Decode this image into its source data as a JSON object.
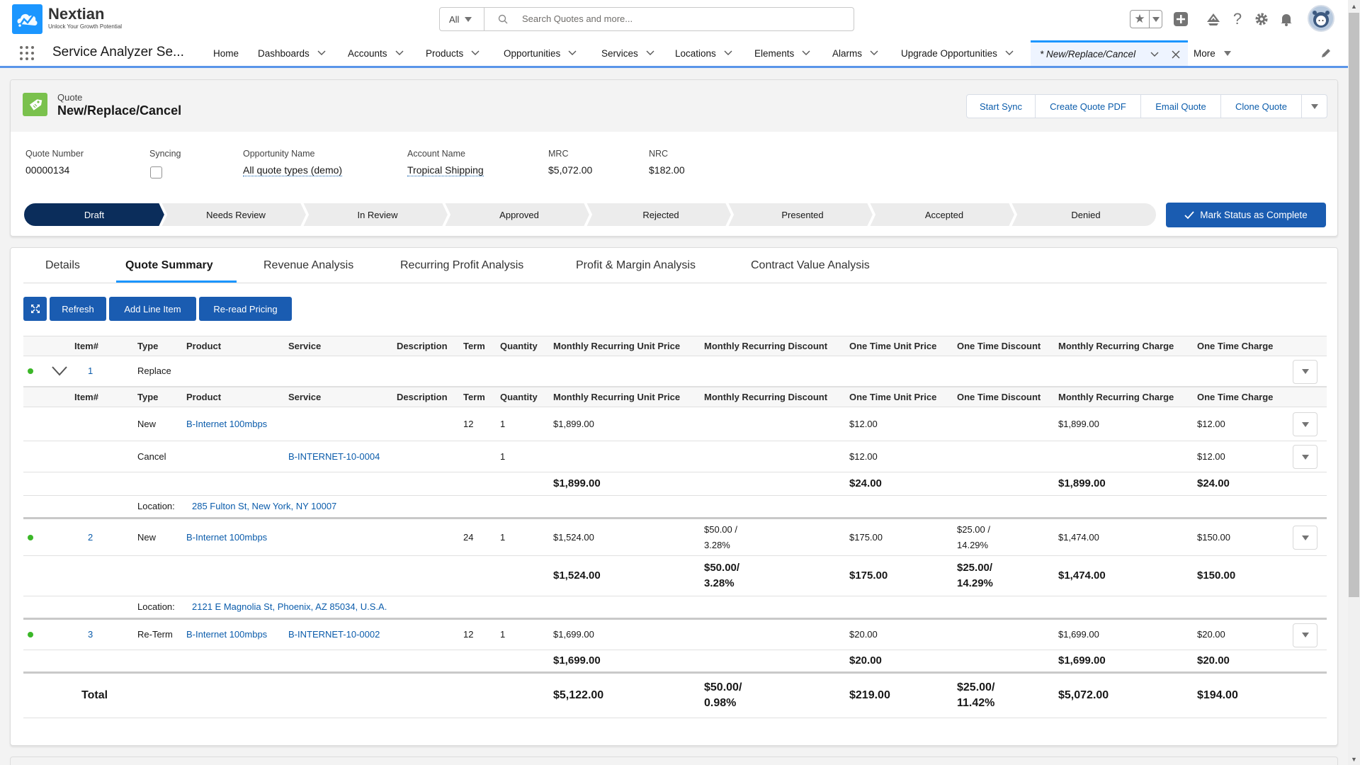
{
  "brand": {
    "name": "Nextian",
    "tagline": "Unlock Your Growth Potential"
  },
  "search": {
    "scope": "All",
    "placeholder": "Search Quotes and more..."
  },
  "header_icons": [
    "favorites-star-icon",
    "add-icon",
    "trailhead-icon",
    "help-icon",
    "setup-gear-icon",
    "notifications-bell-icon",
    "user-avatar"
  ],
  "nav": {
    "app_name": "Service Analyzer Se...",
    "items": [
      {
        "label": "Home",
        "dropdown": false
      },
      {
        "label": "Dashboards",
        "dropdown": true
      },
      {
        "label": "Accounts",
        "dropdown": true
      },
      {
        "label": "Products",
        "dropdown": true
      },
      {
        "label": "Opportunities",
        "dropdown": true
      },
      {
        "label": "Services",
        "dropdown": true
      },
      {
        "label": "Locations",
        "dropdown": true
      },
      {
        "label": "Elements",
        "dropdown": true
      },
      {
        "label": "Alarms",
        "dropdown": true
      },
      {
        "label": "Upgrade Opportunities",
        "dropdown": true
      }
    ],
    "active_tab": "* New/Replace/Cancel",
    "more": "More"
  },
  "record": {
    "object_label": "Quote",
    "title": "New/Replace/Cancel",
    "actions": [
      "Start Sync",
      "Create Quote PDF",
      "Email Quote",
      "Clone Quote"
    ],
    "fields": [
      {
        "label": "Quote Number",
        "value": "00000134"
      },
      {
        "label": "Syncing",
        "value": false
      },
      {
        "label": "Opportunity Name",
        "value": "All quote types (demo)"
      },
      {
        "label": "Account Name",
        "value": "Tropical Shipping"
      },
      {
        "label": "MRC",
        "value": "$5,072.00"
      },
      {
        "label": "NRC",
        "value": "$182.00"
      }
    ],
    "path": {
      "stages": [
        "Draft",
        "Needs Review",
        "In Review",
        "Approved",
        "Rejected",
        "Presented",
        "Accepted",
        "Denied"
      ],
      "current": "Draft",
      "complete_button": "Mark Status as Complete"
    }
  },
  "tabs": [
    {
      "label": "Details",
      "active": false
    },
    {
      "label": "Quote Summary",
      "active": true
    },
    {
      "label": "Revenue Analysis",
      "active": false
    },
    {
      "label": "Recurring Profit Analysis",
      "active": false
    },
    {
      "label": "Profit & Margin Analysis",
      "active": false
    },
    {
      "label": "Contract Value Analysis",
      "active": false
    }
  ],
  "toolbar": {
    "refresh": "Refresh",
    "add_line_item": "Add Line Item",
    "reread_pricing": "Re-read Pricing"
  },
  "table": {
    "columns": [
      "Item#",
      "Type",
      "Product",
      "Service",
      "Description",
      "Term",
      "Quantity",
      "Monthly Recurring Unit Price",
      "Monthly Recurring Discount",
      "One Time Unit Price",
      "One Time Discount",
      "Monthly Recurring Charge",
      "One Time Charge"
    ],
    "location_label": "Location:",
    "groups": [
      {
        "item": "1",
        "type": "Replace",
        "children": [
          {
            "type": "New",
            "product": "B-Internet 100mbps",
            "service": "",
            "term": "12",
            "quantity": "1",
            "mrup": "$1,899.00",
            "mrd": "",
            "otup": "$12.00",
            "otd": "",
            "mrc": "$1,899.00",
            "otc": "$12.00"
          },
          {
            "type": "Cancel",
            "product": "",
            "service": "B-INTERNET-10-0004",
            "term": "",
            "quantity": "1",
            "mrup": "",
            "mrd": "",
            "otup": "$12.00",
            "otd": "",
            "mrc": "",
            "otc": "$12.00"
          }
        ],
        "subtotal": {
          "mrup": "$1,899.00",
          "mrd": "",
          "otup": "$24.00",
          "otd": "",
          "mrc": "$1,899.00",
          "otc": "$24.00"
        },
        "location": "285 Fulton St, New York, NY 10007"
      },
      {
        "item": "2",
        "type": "New",
        "product": "B-Internet 100mbps",
        "service": "",
        "term": "24",
        "quantity": "1",
        "mrup": "$1,524.00",
        "mrd": "$50.00 / 3.28%",
        "otup": "$175.00",
        "otd": "$25.00 / 14.29%",
        "mrc": "$1,474.00",
        "otc": "$150.00",
        "subtotal": {
          "mrup": "$1,524.00",
          "mrd": "$50.00/ 3.28%",
          "otup": "$175.00",
          "otd": "$25.00/ 14.29%",
          "mrc": "$1,474.00",
          "otc": "$150.00"
        },
        "location": "2121 E Magnolia St, Phoenix, AZ 85034, U.S.A."
      },
      {
        "item": "3",
        "type": "Re-Term",
        "product": "B-Internet 100mbps",
        "service": "B-INTERNET-10-0002",
        "term": "12",
        "quantity": "1",
        "mrup": "$1,699.00",
        "mrd": "",
        "otup": "$20.00",
        "otd": "",
        "mrc": "$1,699.00",
        "otc": "$20.00",
        "subtotal": {
          "mrup": "$1,699.00",
          "mrd": "",
          "otup": "$20.00",
          "otd": "",
          "mrc": "$1,699.00",
          "otc": "$20.00"
        }
      }
    ],
    "total": {
      "label": "Total",
      "mrup": "$5,122.00",
      "mrd": "$50.00/ 0.98%",
      "otup": "$219.00",
      "otd": "$25.00/ 11.42%",
      "mrc": "$5,072.00",
      "otc": "$194.00"
    }
  },
  "colors": {
    "brand_blue": "#1a5cb1",
    "path_current": "#0b2d5b",
    "status_dot": "#3bb728",
    "link": "#0b5cab"
  }
}
